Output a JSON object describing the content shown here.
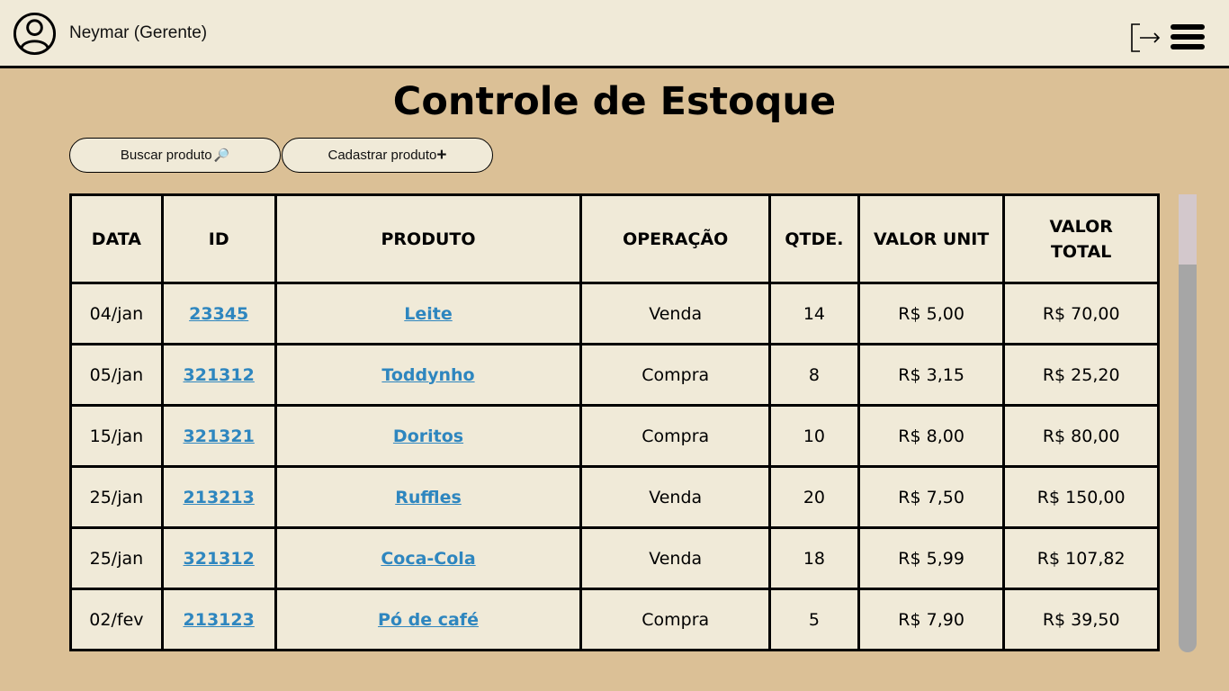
{
  "header": {
    "user_name": "Neymar (Gerente)",
    "icons": {
      "avatar": "user-circle-icon",
      "logout": "logout-icon",
      "menu": "hamburger-menu-icon"
    }
  },
  "page": {
    "title": "Controle de Estoque"
  },
  "toolbar": {
    "search_label": "Buscar produto",
    "search_icon": "🔎",
    "add_label": "Cadastrar produto",
    "add_icon": "+"
  },
  "table": {
    "headers": [
      "DATA",
      "ID",
      "PRODUTO",
      "OPERAÇÃO",
      "QTDE.",
      "VALOR UNIT",
      "VALOR TOTAL"
    ],
    "rows": [
      {
        "data": "04/jan",
        "id": "23345",
        "produto": "Leite",
        "operacao": "Venda",
        "qtde": "14",
        "valor_unit": "R$ 5,00",
        "valor_total": "R$ 70,00"
      },
      {
        "data": "05/jan",
        "id": "321312",
        "produto": "Toddynho",
        "operacao": "Compra",
        "qtde": "8",
        "valor_unit": "R$ 3,15",
        "valor_total": "R$ 25,20"
      },
      {
        "data": "15/jan",
        "id": "321321",
        "produto": "Doritos",
        "operacao": "Compra",
        "qtde": "10",
        "valor_unit": "R$ 8,00",
        "valor_total": "R$ 80,00"
      },
      {
        "data": "25/jan",
        "id": "213213",
        "produto": "Ruffles",
        "operacao": "Venda",
        "qtde": "20",
        "valor_unit": "R$ 7,50",
        "valor_total": "R$ 150,00"
      },
      {
        "data": "25/jan",
        "id": "321312",
        "produto": "Coca-Cola",
        "operacao": "Venda",
        "qtde": "18",
        "valor_unit": "R$ 5,99",
        "valor_total": "R$ 107,82"
      },
      {
        "data": "02/fev",
        "id": "213123",
        "produto": "Pó de café",
        "operacao": "Compra",
        "qtde": "5",
        "valor_unit": "R$ 7,90",
        "valor_total": "R$ 39,50"
      }
    ]
  },
  "colors": {
    "background": "#dbc096",
    "panel": "#f0ead8",
    "link": "#2e86bf",
    "scroll_track": "#a6a6a6",
    "scroll_thumb": "#d3c8cc"
  }
}
